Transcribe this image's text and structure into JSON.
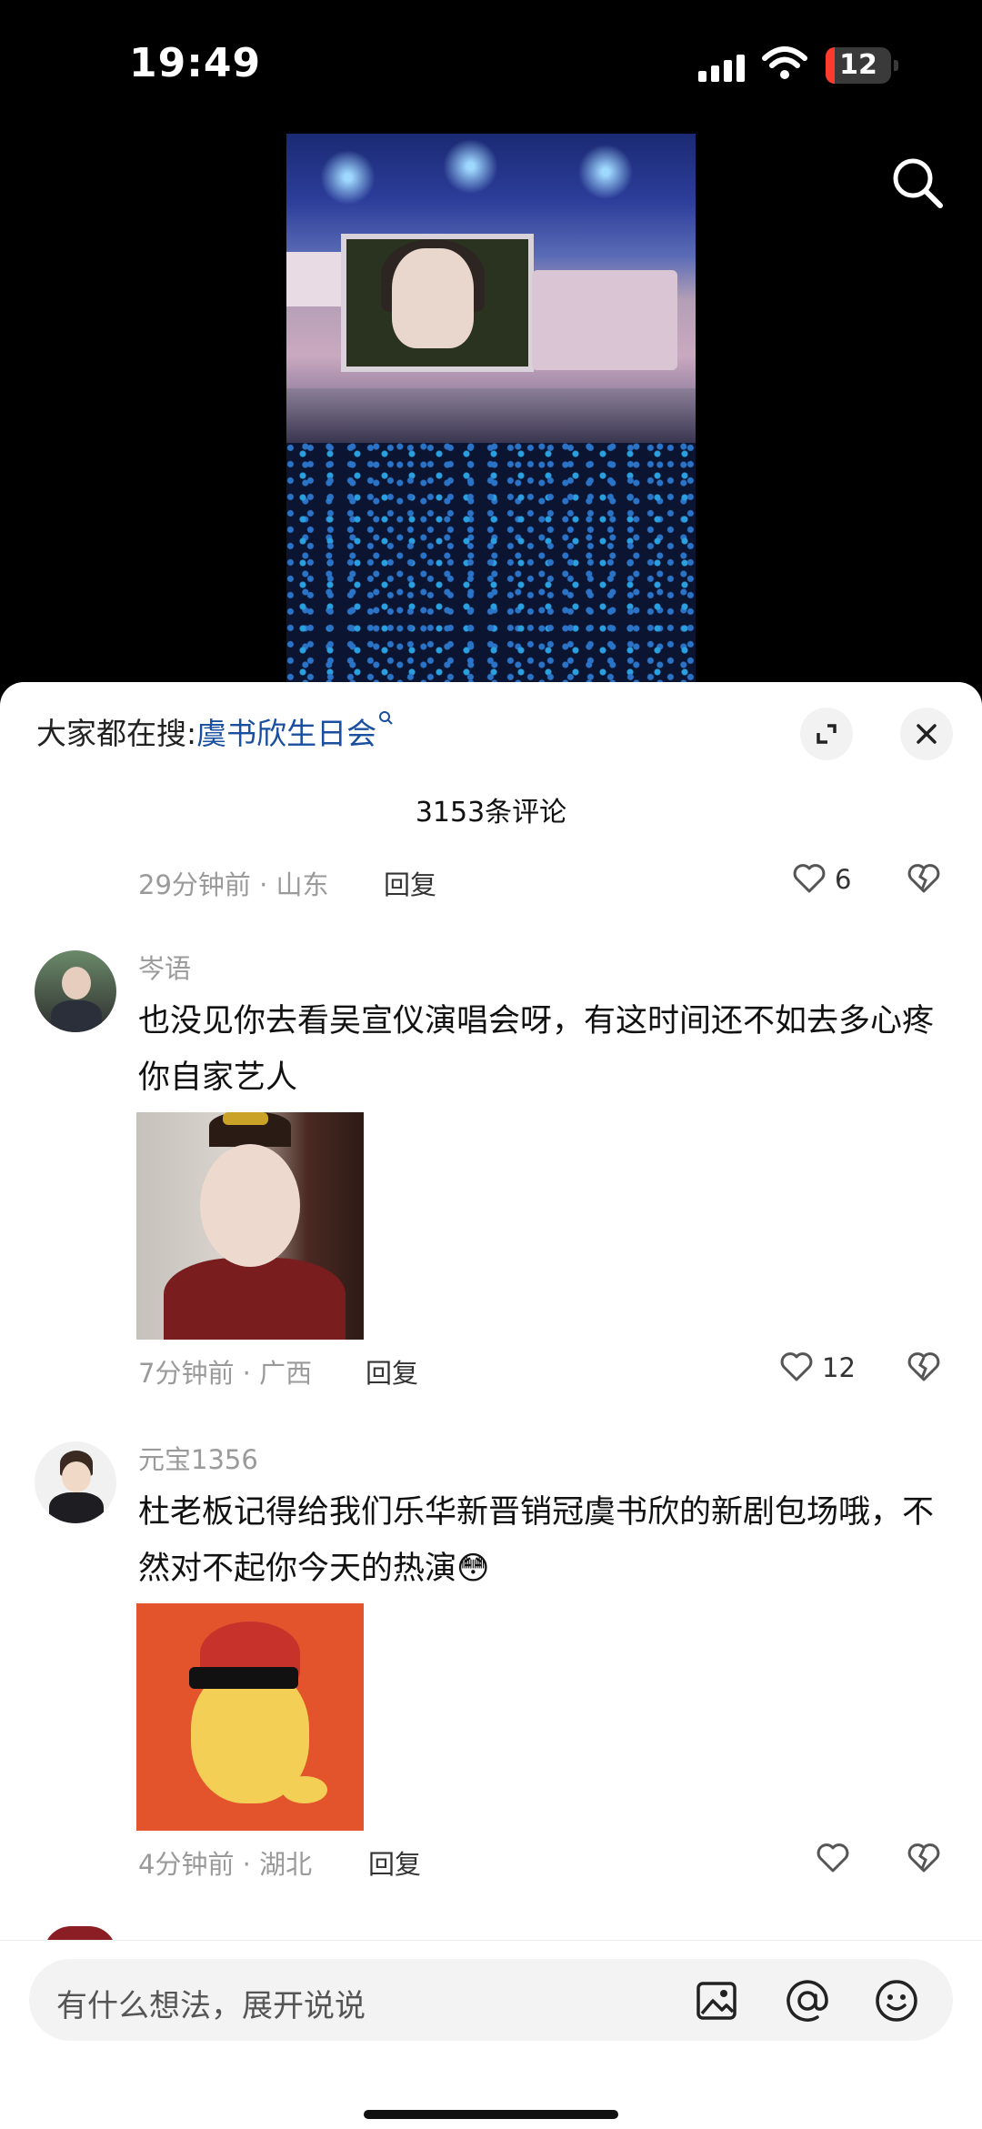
{
  "status_bar": {
    "time": "19:49",
    "battery": "12"
  },
  "sheet": {
    "search_prefix": "大家都在搜:",
    "search_keyword": "虞书欣生日会",
    "comment_count": "3153条评论"
  },
  "comments": [
    {
      "meta": "29分钟前 · 山东",
      "reply": "回复",
      "likes": "6"
    },
    {
      "username": "岑语",
      "text": "也没见你去看吴宣仪演唱会呀，有这时间还不如去多心疼你自家艺人",
      "meta": "7分钟前 · 广西",
      "reply": "回复",
      "likes": "12"
    },
    {
      "username": "元宝1356",
      "text": "杜老板记得给我们乐华新晋销冠虞书欣的新剧包场哦，不然对不起你今天的热演😳",
      "meta": "4分钟前 · 湖北",
      "reply": "回复",
      "likes": ""
    }
  ],
  "composer": {
    "placeholder": "有什么想法，展开说说"
  },
  "icons": [
    "search-icon",
    "expand-icon",
    "close-icon",
    "heart-icon",
    "broken-heart-icon",
    "image-icon",
    "at-icon",
    "emoji-icon"
  ],
  "colors": {
    "keyword_link": "#1a4fa0",
    "battery_low": "#ff3b30"
  }
}
